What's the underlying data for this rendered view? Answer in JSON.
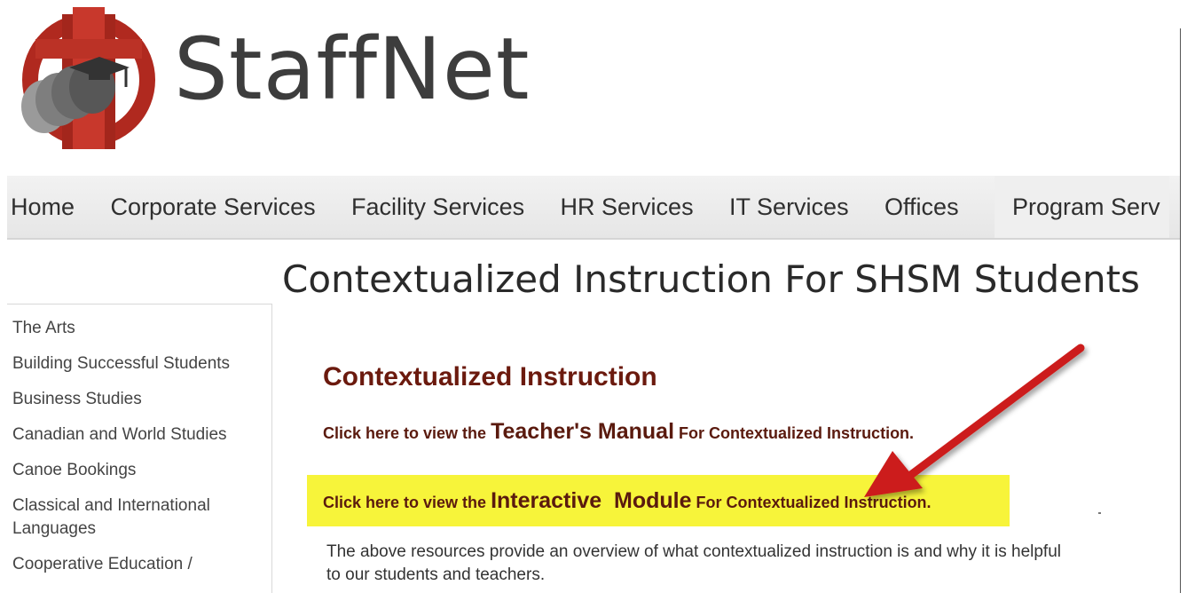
{
  "header": {
    "brand_name": "StaffNet",
    "logo_icon": "staffnet-logo-icon",
    "logo_colors": {
      "ring": "#b0291f",
      "figures": "#6a6a6a"
    }
  },
  "nav": {
    "items": [
      {
        "label": "Home"
      },
      {
        "label": "Corporate Services"
      },
      {
        "label": "Facility Services"
      },
      {
        "label": "HR Services"
      },
      {
        "label": "IT Services"
      },
      {
        "label": "Offices"
      },
      {
        "label": "Program Serv"
      }
    ]
  },
  "page": {
    "title": "Contextualized Instruction For SHSM Students"
  },
  "sidebar": {
    "items": [
      {
        "label": "The Arts"
      },
      {
        "label": "Building Successful Students"
      },
      {
        "label": "Business Studies"
      },
      {
        "label": "Canadian and World Studies"
      },
      {
        "label": "Canoe Bookings"
      },
      {
        "label": "Classical and International Languages"
      },
      {
        "label": "Cooperative Education /"
      }
    ]
  },
  "content": {
    "heading": "Contextualized Instruction",
    "teacher_manual": {
      "prefix": "Click here to view the",
      "link_text": "Teacher's Manual",
      "suffix": "For Contextualized Instruction."
    },
    "interactive_module": {
      "prefix": "Click here to view the",
      "link_text": "Interactive  Module",
      "suffix": "For Contextualized Instruction."
    },
    "description": "The above resources provide an overview of what contextualized instruction is and why it is helpful to our students and teachers."
  },
  "colors": {
    "highlight": "#f7f43a",
    "heading": "#6b1a0e",
    "arrow": "#cc1f1a"
  }
}
